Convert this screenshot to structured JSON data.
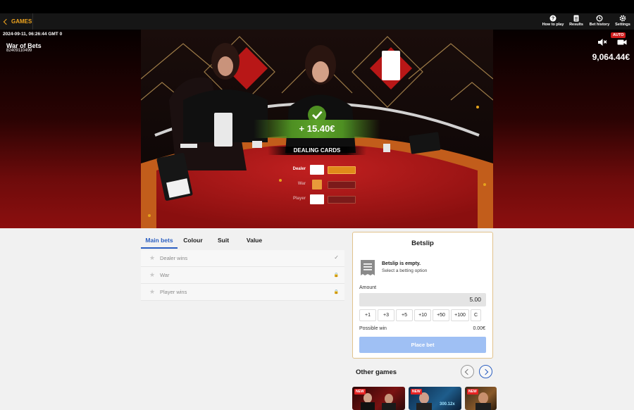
{
  "nav": {
    "games_label": "GAMES",
    "items": [
      {
        "label": "How to play",
        "icon": "question-icon"
      },
      {
        "label": "Results",
        "icon": "results-icon"
      },
      {
        "label": "Bet history",
        "icon": "history-icon"
      },
      {
        "label": "Settings",
        "icon": "gear-icon"
      }
    ]
  },
  "stream": {
    "timestamp": "2024-09-11, 06:26:44 GMT 0",
    "game_title": "War of Bets",
    "game_id": "82409110499",
    "balance": "9,064.44€",
    "auto_badge": "AUTO",
    "win_amount": "+ 15.40€",
    "status": "DEALING CARDS",
    "rows": [
      {
        "label": "Dealer",
        "active": true
      },
      {
        "label": "War",
        "active": false
      },
      {
        "label": "Player",
        "active": false
      }
    ]
  },
  "tabs": [
    "Main bets",
    "Colour",
    "Suit",
    "Value"
  ],
  "bets": [
    {
      "name": "Dealer wins",
      "status": "✓"
    },
    {
      "name": "War",
      "status": "🔒"
    },
    {
      "name": "Player wins",
      "status": "🔒"
    }
  ],
  "betslip": {
    "title": "Betslip",
    "empty_title": "Betslip is empty.",
    "empty_hint": "Select a betting option",
    "amount_label": "Amount",
    "amount_value": "5.00",
    "chips": [
      "+1",
      "+3",
      "+5",
      "+10",
      "+50",
      "+100",
      "C"
    ],
    "possible_win_label": "Possible win",
    "possible_win_value": "0.00€",
    "place_bet_label": "Place bet"
  },
  "other_games": {
    "title": "Other games",
    "badge": "NEW",
    "thumb_texts": [
      "",
      "300.12x",
      ""
    ]
  },
  "colors": {
    "accent": "#2b5fc1",
    "games": "#f0a51f",
    "win_green": "#4e8f22",
    "felt_red": "#a51717"
  }
}
